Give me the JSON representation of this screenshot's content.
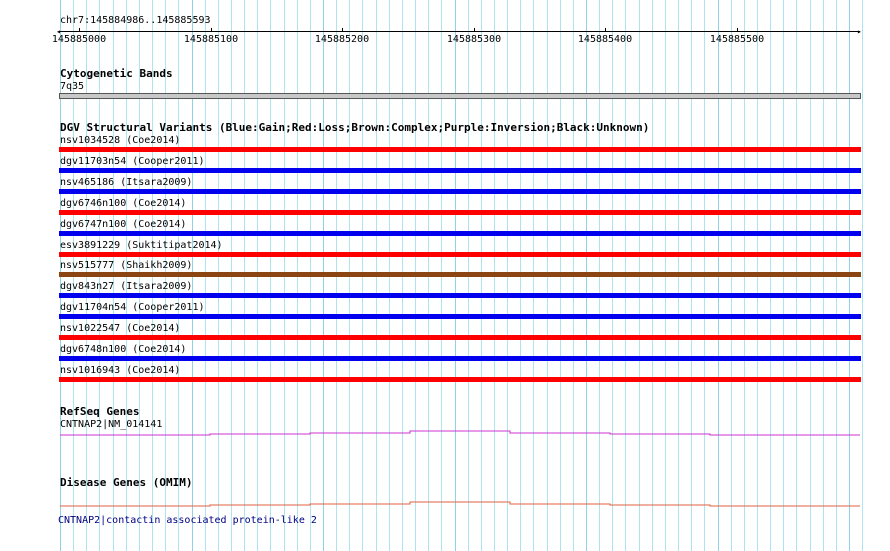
{
  "location": {
    "label": "chr7:145884986..145885593"
  },
  "ruler": {
    "ticks": [
      "145885000",
      "145885100",
      "145885200",
      "145885300",
      "145885400",
      "145885500"
    ]
  },
  "tracks": {
    "cytobands": {
      "title": "Cytogenetic Bands",
      "band_label": "7q35",
      "band_color": "#c8c8c8"
    },
    "dgv": {
      "title": "DGV Structural Variants (Blue:Gain;Red:Loss;Brown:Complex;Purple:Inversion;Black:Unknown)",
      "colors": {
        "gain": "#0000ee",
        "loss": "#ff0000",
        "complex": "#8b4513"
      },
      "variants": [
        {
          "label": "nsv1034528 (Coe2014)",
          "type": "loss"
        },
        {
          "label": "dgv11703n54 (Cooper2011)",
          "type": "gain"
        },
        {
          "label": "nsv465186 (Itsara2009)",
          "type": "gain"
        },
        {
          "label": "dgv6746n100 (Coe2014)",
          "type": "loss"
        },
        {
          "label": "dgv6747n100 (Coe2014)",
          "type": "gain"
        },
        {
          "label": "esv3891229 (Suktitipat2014)",
          "type": "loss"
        },
        {
          "label": "nsv515777 (Shaikh2009)",
          "type": "complex"
        },
        {
          "label": "dgv843n27 (Itsara2009)",
          "type": "gain"
        },
        {
          "label": "dgv11704n54 (Cooper2011)",
          "type": "gain"
        },
        {
          "label": "nsv1022547 (Coe2014)",
          "type": "loss"
        },
        {
          "label": "dgv6748n100 (Coe2014)",
          "type": "gain"
        },
        {
          "label": "nsv1016943 (Coe2014)",
          "type": "loss"
        }
      ]
    },
    "refseq": {
      "title": "RefSeq Genes",
      "gene_label": "CNTNAP2|NM_014141",
      "color": "#cc33cc"
    },
    "omim": {
      "title": "Disease Genes (OMIM)",
      "gene_label": "CNTNAP2|contactin associated protein-like 2",
      "color": "#e06040",
      "label_color": "#000080"
    }
  }
}
